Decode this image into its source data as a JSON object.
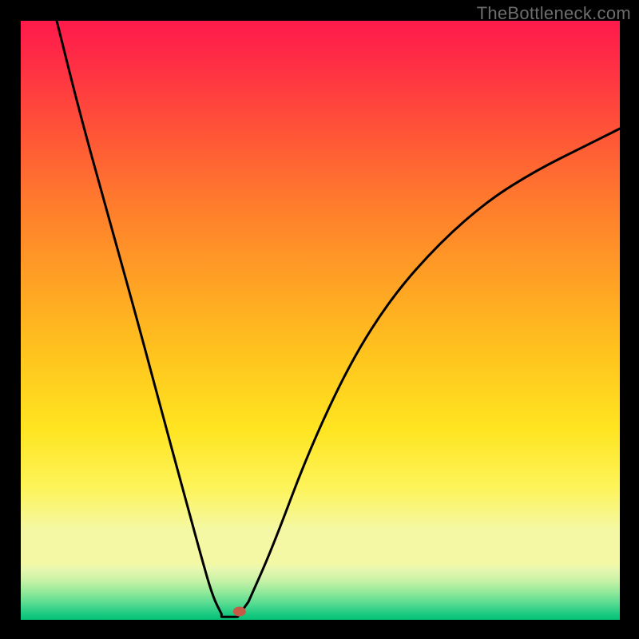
{
  "watermark": "TheBottleneck.com",
  "chart_data": {
    "type": "line",
    "title": "",
    "xlabel": "",
    "ylabel": "",
    "xlim": [
      0,
      100
    ],
    "ylim": [
      0,
      100
    ],
    "grid": false,
    "legend": false,
    "series": [
      {
        "name": "curve",
        "x": [
          6,
          10,
          15,
          20,
          24,
          27,
          30,
          32,
          33.5,
          34,
          35,
          36,
          38,
          42,
          48,
          55,
          62,
          70,
          78,
          86,
          94,
          100
        ],
        "y": [
          100,
          84,
          66,
          48,
          33,
          22,
          11,
          4,
          1,
          0.5,
          0.5,
          0.5,
          3,
          12,
          28,
          43,
          54,
          63,
          70,
          75,
          79,
          82
        ]
      }
    ],
    "flat_bottom": {
      "x": [
        33.5,
        36.2
      ],
      "y": 0.5
    },
    "marker": {
      "x": 36.5,
      "y": 1.4,
      "color": "#c55a47"
    },
    "gradient_stops": [
      {
        "offset": 0.0,
        "color": "#ff1a4b"
      },
      {
        "offset": 0.07,
        "color": "#ff2e45"
      },
      {
        "offset": 0.18,
        "color": "#ff5238"
      },
      {
        "offset": 0.3,
        "color": "#ff7a2d"
      },
      {
        "offset": 0.42,
        "color": "#ff9d25"
      },
      {
        "offset": 0.55,
        "color": "#ffc21e"
      },
      {
        "offset": 0.68,
        "color": "#ffe420"
      },
      {
        "offset": 0.78,
        "color": "#fdf45a"
      },
      {
        "offset": 0.85,
        "color": "#f4f8a4"
      },
      {
        "offset": 0.905,
        "color": "#f4f8a4"
      },
      {
        "offset": 0.915,
        "color": "#e8f7b0"
      },
      {
        "offset": 0.935,
        "color": "#c6f2a6"
      },
      {
        "offset": 0.955,
        "color": "#8fe89a"
      },
      {
        "offset": 0.975,
        "color": "#4fd98f"
      },
      {
        "offset": 0.992,
        "color": "#15c97f"
      },
      {
        "offset": 1.0,
        "color": "#06c176"
      }
    ]
  }
}
